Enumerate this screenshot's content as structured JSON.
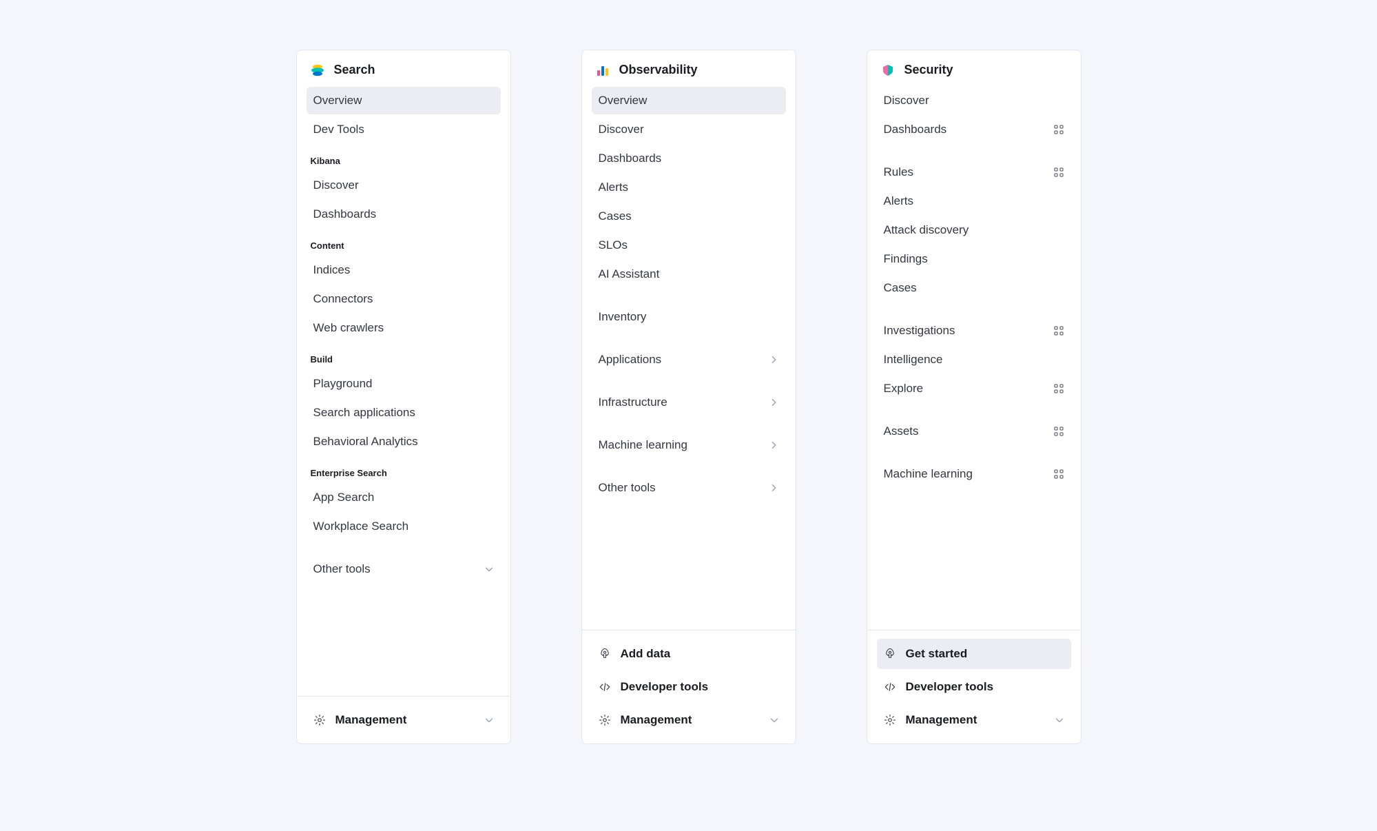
{
  "panels": [
    {
      "id": "search",
      "title": "Search",
      "icon": "elastic-logo",
      "sections": [
        {
          "label": null,
          "items": [
            {
              "id": "overview",
              "label": "Overview",
              "selected": true
            },
            {
              "id": "dev-tools",
              "label": "Dev Tools"
            }
          ]
        },
        {
          "label": "Kibana",
          "items": [
            {
              "id": "discover",
              "label": "Discover"
            },
            {
              "id": "dashboards",
              "label": "Dashboards"
            }
          ]
        },
        {
          "label": "Content",
          "items": [
            {
              "id": "indices",
              "label": "Indices"
            },
            {
              "id": "connectors",
              "label": "Connectors"
            },
            {
              "id": "web-crawlers",
              "label": "Web crawlers"
            }
          ]
        },
        {
          "label": "Build",
          "items": [
            {
              "id": "playground",
              "label": "Playground"
            },
            {
              "id": "search-applications",
              "label": "Search applications"
            },
            {
              "id": "behavioral-analytics",
              "label": "Behavioral Analytics"
            }
          ]
        },
        {
          "label": "Enterprise Search",
          "items": [
            {
              "id": "app-search",
              "label": "App Search"
            },
            {
              "id": "workplace-search",
              "label": "Workplace Search"
            }
          ]
        },
        {
          "label": null,
          "spacer": true,
          "items": [
            {
              "id": "other-tools",
              "label": "Other tools",
              "chevron": "down"
            }
          ]
        }
      ],
      "footer": [
        {
          "id": "management",
          "label": "Management",
          "icon": "gear",
          "chevron": "down"
        }
      ]
    },
    {
      "id": "observability",
      "title": "Observability",
      "icon": "observability-logo",
      "sections": [
        {
          "label": null,
          "items": [
            {
              "id": "overview",
              "label": "Overview",
              "selected": true
            },
            {
              "id": "discover",
              "label": "Discover"
            },
            {
              "id": "dashboards",
              "label": "Dashboards"
            },
            {
              "id": "alerts",
              "label": "Alerts"
            },
            {
              "id": "cases",
              "label": "Cases"
            },
            {
              "id": "slos",
              "label": "SLOs"
            },
            {
              "id": "ai-assistant",
              "label": "AI Assistant"
            }
          ]
        },
        {
          "label": null,
          "spacer": true,
          "items": [
            {
              "id": "inventory",
              "label": "Inventory"
            }
          ]
        },
        {
          "label": null,
          "spacer": true,
          "items": [
            {
              "id": "applications",
              "label": "Applications",
              "chevron": "right"
            }
          ]
        },
        {
          "label": null,
          "spacer": true,
          "items": [
            {
              "id": "infrastructure",
              "label": "Infrastructure",
              "chevron": "right"
            }
          ]
        },
        {
          "label": null,
          "spacer": true,
          "items": [
            {
              "id": "machine-learning",
              "label": "Machine learning",
              "chevron": "right"
            }
          ]
        },
        {
          "label": null,
          "spacer": true,
          "items": [
            {
              "id": "other-tools",
              "label": "Other tools",
              "chevron": "right"
            }
          ]
        }
      ],
      "footer": [
        {
          "id": "add-data",
          "label": "Add data",
          "icon": "rocket"
        },
        {
          "id": "developer-tools",
          "label": "Developer tools",
          "icon": "code"
        },
        {
          "id": "management",
          "label": "Management",
          "icon": "gear",
          "chevron": "down"
        }
      ]
    },
    {
      "id": "security",
      "title": "Security",
      "icon": "security-logo",
      "sections": [
        {
          "label": null,
          "items": [
            {
              "id": "discover",
              "label": "Discover"
            },
            {
              "id": "dashboards",
              "label": "Dashboards",
              "trailing": "grid"
            }
          ]
        },
        {
          "label": null,
          "spacer": true,
          "items": [
            {
              "id": "rules",
              "label": "Rules",
              "trailing": "grid"
            },
            {
              "id": "alerts",
              "label": "Alerts"
            },
            {
              "id": "attack-discovery",
              "label": "Attack discovery"
            },
            {
              "id": "findings",
              "label": "Findings"
            },
            {
              "id": "cases",
              "label": "Cases"
            }
          ]
        },
        {
          "label": null,
          "spacer": true,
          "items": [
            {
              "id": "investigations",
              "label": "Investigations",
              "trailing": "grid"
            },
            {
              "id": "intelligence",
              "label": "Intelligence"
            },
            {
              "id": "explore",
              "label": "Explore",
              "trailing": "grid"
            }
          ]
        },
        {
          "label": null,
          "spacer": true,
          "items": [
            {
              "id": "assets",
              "label": "Assets",
              "trailing": "grid"
            }
          ]
        },
        {
          "label": null,
          "spacer": true,
          "items": [
            {
              "id": "machine-learning",
              "label": "Machine learning",
              "trailing": "grid"
            }
          ]
        }
      ],
      "footer": [
        {
          "id": "get-started",
          "label": "Get started",
          "icon": "rocket",
          "selected": true
        },
        {
          "id": "developer-tools",
          "label": "Developer tools",
          "icon": "code"
        },
        {
          "id": "management",
          "label": "Management",
          "icon": "gear",
          "chevron": "down"
        }
      ]
    }
  ]
}
